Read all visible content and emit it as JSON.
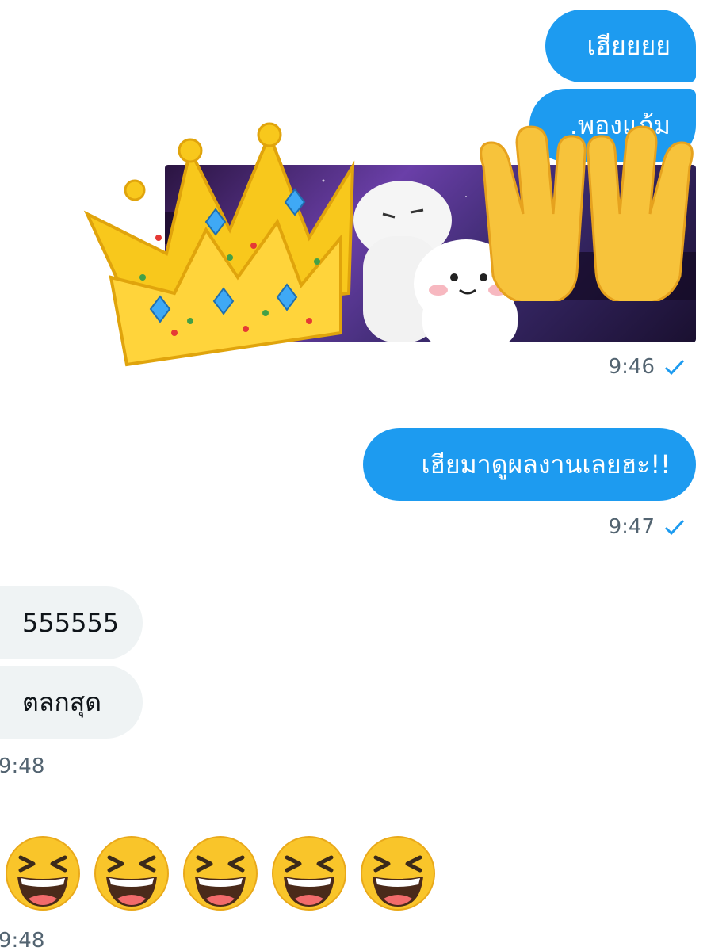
{
  "messages": {
    "out1": "เฮียยยย",
    "out2": ".พองแก้ม",
    "out3": "เฮียมาดูผลงานเลยฮะ!!",
    "in1": "555555",
    "in2": "ตลกสุด"
  },
  "timestamps": {
    "t1": "9:46",
    "t2": "9:47",
    "t3": "9:48",
    "t4": "9:48"
  },
  "icons": {
    "read_receipt": "check-icon",
    "sticker_crown": "crown-icon",
    "sticker_hands": "raised-hands-icon",
    "laughing_face": "laughing-face-icon"
  },
  "emoji_count": 5,
  "colors": {
    "outgoing_bubble": "#1d9bf0",
    "incoming_bubble": "#eff3f4",
    "timestamp": "#536471",
    "check": "#1d9bf0"
  }
}
